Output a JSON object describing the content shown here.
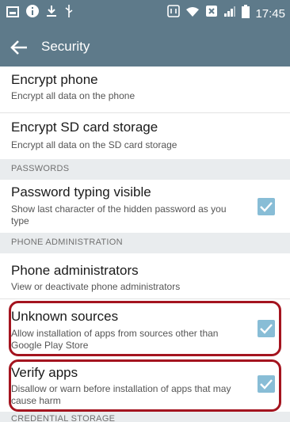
{
  "status_bar": {
    "time": "17:45",
    "icons": [
      "screenshot-icon",
      "info-icon",
      "download-icon",
      "usb-icon",
      "nfc-icon",
      "wifi-icon",
      "data-saver-icon",
      "signal-icon",
      "battery-icon"
    ]
  },
  "app_bar": {
    "title": "Security"
  },
  "prefs": {
    "encrypt_phone": {
      "title": "Encrypt phone",
      "summary": "Encrypt all data on the phone"
    },
    "encrypt_sd": {
      "title": "Encrypt SD card storage",
      "summary": "Encrypt all data on the SD card storage"
    },
    "passwords_header": "PASSWORDS",
    "password_visible": {
      "title": "Password typing visible",
      "summary": "Show last character of the hidden password as you type",
      "checked": true
    },
    "phone_admin_header": "PHONE ADMINISTRATION",
    "phone_admins": {
      "title": "Phone administrators",
      "summary": "View or deactivate phone administrators"
    },
    "unknown_sources": {
      "title": "Unknown sources",
      "summary": "Allow installation of apps from sources other than Google Play Store",
      "checked": true
    },
    "verify_apps": {
      "title": "Verify apps",
      "summary": "Disallow or warn before installation of apps that may cause harm",
      "checked": true
    },
    "credential_header": "CREDENTIAL STORAGE"
  },
  "colors": {
    "bar": "#5e7a8a",
    "checkbox": "#88bdd6",
    "highlight": "#a4141f"
  }
}
